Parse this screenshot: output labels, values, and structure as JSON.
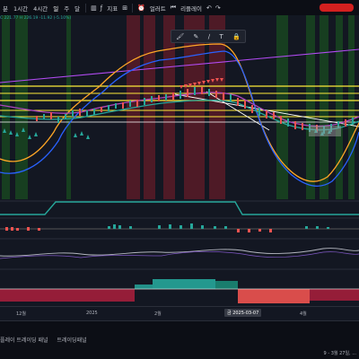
{
  "toolbar": {
    "items": [
      {
        "label": "분",
        "name": "tf-minute"
      },
      {
        "label": "1시간",
        "name": "tf-1h"
      },
      {
        "label": "4시간",
        "name": "tf-4h"
      },
      {
        "label": "일",
        "name": "tf-day",
        "active": true
      },
      {
        "label": "주",
        "name": "tf-week"
      },
      {
        "label": "달",
        "name": "tf-month"
      }
    ],
    "indicators_label": "지표",
    "alert_label": "얼러트",
    "replay_label": "리플레이"
  },
  "ohlc_text": "C 221.77  H 226.19  -11.92 (-5.10%)",
  "drawing_toolbar": {
    "icons": [
      "brush-tool",
      "pencil-tool",
      "trend-line-tool",
      "text-tool",
      "lock-tool"
    ]
  },
  "time_axis": {
    "ticks": [
      "12월",
      "2025",
      "2월",
      "4월"
    ],
    "crosshair": "금 2025-03-07"
  },
  "bottom_tabs": [
    "플레이 트레이딩 패널",
    "트레이딩패널"
  ],
  "status_date": "9 - 3월 27일, ..."
}
